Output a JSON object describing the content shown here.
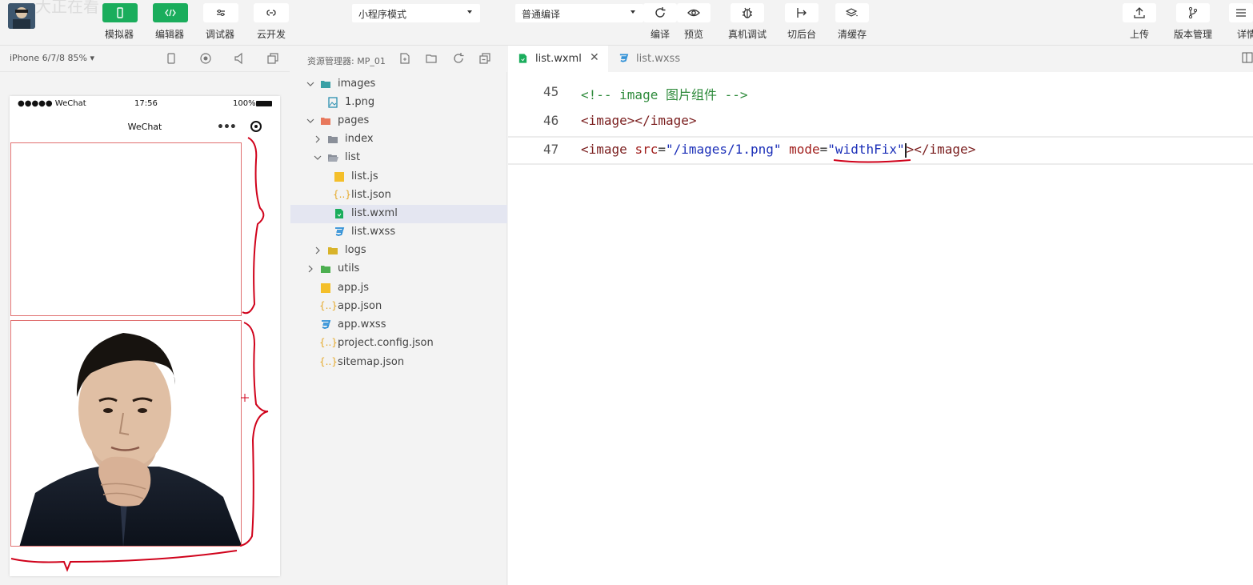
{
  "toolbar": {
    "ghost_text": "大正在看",
    "simulator_label": "模拟器",
    "editor_label": "编辑器",
    "debugger_label": "调试器",
    "cloud_label": "云开发",
    "mode_select": "小程序模式",
    "compile_select": "普通编译",
    "compile_label": "编译",
    "preview_label": "预览",
    "device_debug_label": "真机调试",
    "background_label": "切后台",
    "clear_cache_label": "清缓存",
    "upload_label": "上传",
    "version_label": "版本管理",
    "details_label": "详情"
  },
  "simulator": {
    "device": "iPhone 6/7/8 85% ▾",
    "status_carrier": "●●●●● WeChat",
    "status_time": "17:56",
    "status_battery": "100%",
    "nav_title": "WeChat"
  },
  "explorer": {
    "title": "资源管理器: MP_01",
    "items": [
      {
        "name": "images",
        "type": "folder-teal",
        "expanded": true
      },
      {
        "name": "1.png",
        "type": "image"
      },
      {
        "name": "pages",
        "type": "folder-orange",
        "expanded": true
      },
      {
        "name": "index",
        "type": "folder",
        "expanded": false
      },
      {
        "name": "list",
        "type": "folder-open",
        "expanded": true
      },
      {
        "name": "list.js",
        "type": "js"
      },
      {
        "name": "list.json",
        "type": "json"
      },
      {
        "name": "list.wxml",
        "type": "wxml",
        "selected": true
      },
      {
        "name": "list.wxss",
        "type": "wxss"
      },
      {
        "name": "logs",
        "type": "folder-yellow",
        "expanded": false
      },
      {
        "name": "utils",
        "type": "folder-green",
        "expanded": false
      },
      {
        "name": "app.js",
        "type": "js"
      },
      {
        "name": "app.json",
        "type": "json"
      },
      {
        "name": "app.wxss",
        "type": "wxss"
      },
      {
        "name": "project.config.json",
        "type": "json"
      },
      {
        "name": "sitemap.json",
        "type": "json"
      }
    ]
  },
  "tabs": [
    {
      "label": "list.wxml",
      "active": true
    },
    {
      "label": "list.wxss",
      "active": false
    }
  ],
  "tab_close": "✕",
  "editor": {
    "lines": [
      {
        "num": "45",
        "comment": "<!-- image 图片组件 -->"
      },
      {
        "num": "46",
        "tag": "<image></image>"
      },
      {
        "num": "47",
        "open": "<image ",
        "attr1": "src",
        "eq1": "=",
        "val1": "\"/images/1.png\"",
        "space": " ",
        "attr2": "mode",
        "eq2": "=",
        "val2": "\"widthFix\"",
        "close": "></image>"
      }
    ]
  },
  "colors": {
    "green": "#1aad5c",
    "annotation_red": "#d0021b"
  }
}
